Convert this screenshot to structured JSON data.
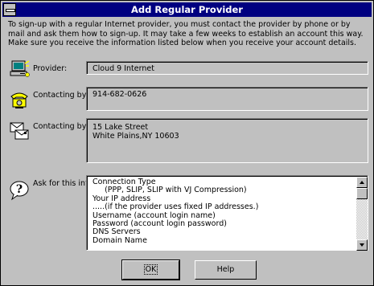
{
  "window": {
    "title": "Add Regular Provider"
  },
  "intro": {
    "text": "To sign-up with a regular Internet provider, you must contact the provider by phone or by mail and ask them how to sign-up. It may take a few weeks to establish an account this way. Make sure you receive the information listed below when you receive your account details."
  },
  "provider": {
    "label": "Provider:",
    "value": "Cloud 9 Internet",
    "icon": "computer-icon"
  },
  "phone": {
    "label": "Contacting by phone:",
    "value": "914-682-0626",
    "icon": "telephone-icon"
  },
  "mail": {
    "label": "Contacting by mail:",
    "value": "15 Lake Street\nWhite Plains,NY 10603",
    "icon": "mail-envelope-icon"
  },
  "ask": {
    "label": "Ask for this information:",
    "icon": "question-bubble-icon",
    "lines": [
      "Connection Type",
      "     (PPP, SLIP, SLIP with VJ Compression)",
      "Your IP address",
      ".....(if the provider uses fixed IP addresses.)",
      "Username (account login name)",
      "Password (account login password)",
      "DNS Servers",
      "Domain Name"
    ]
  },
  "buttons": {
    "ok": "OK",
    "help": "Help"
  }
}
